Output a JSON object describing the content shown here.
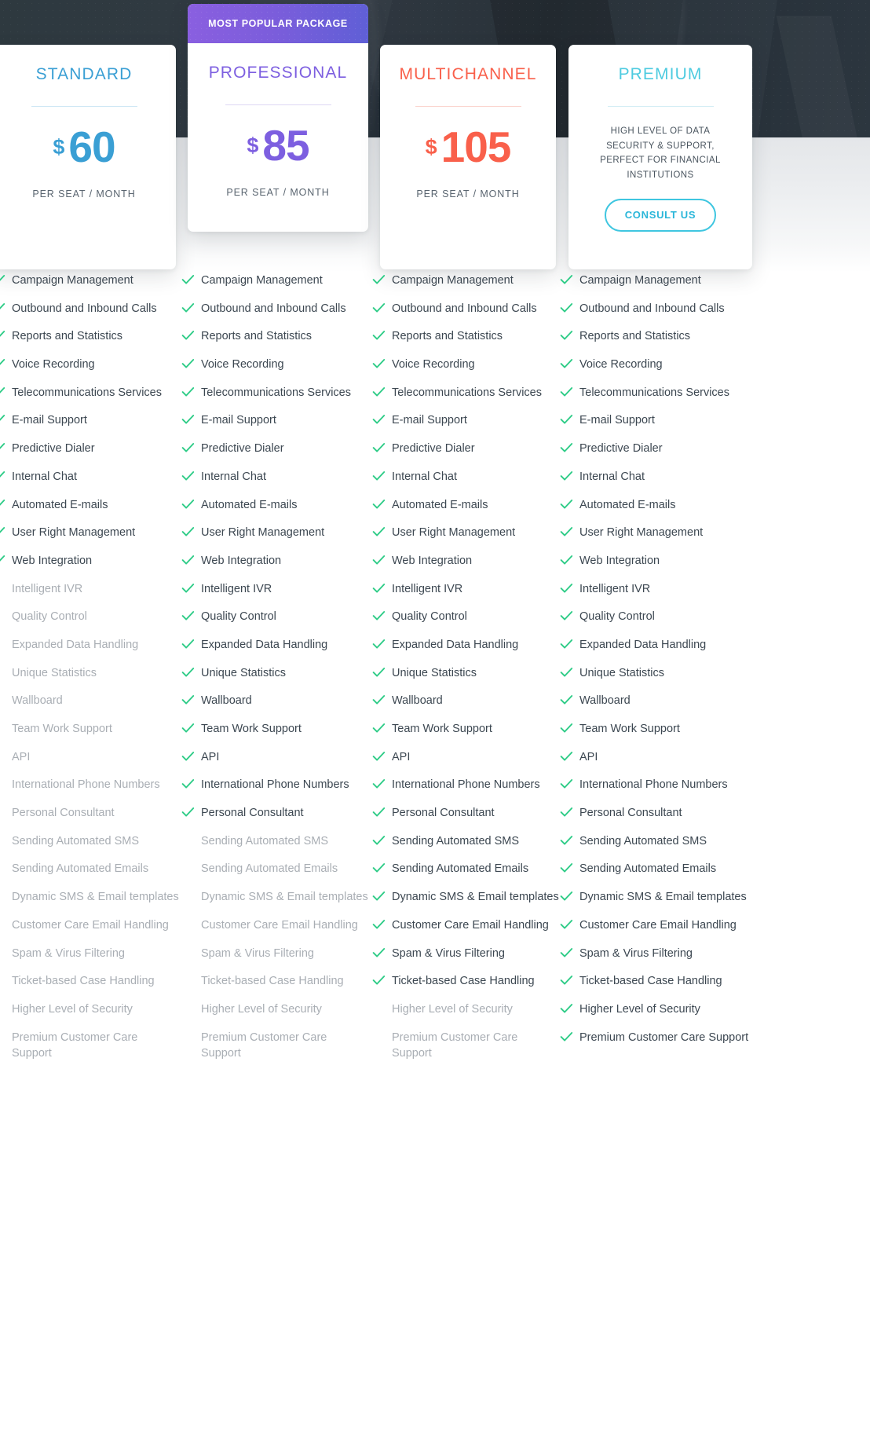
{
  "hero": {
    "popular_badge": "MOST POPULAR PACKAGE"
  },
  "colors": {
    "standard": "#3a9fd4",
    "professional": "#7d5fe0",
    "multichannel": "#f9604b",
    "premium": "#4ecbe0",
    "check": "#2ecc87",
    "disabled_text": "#a9aeb4",
    "enabled_text": "#3c4751",
    "banner_gradient_start": "#8a5fe0",
    "banner_gradient_end": "#5f5fd6",
    "hero_background": "#263238"
  },
  "plans": [
    {
      "name": "STANDARD",
      "currency": "$",
      "price": "60",
      "period": "PER SEAT / MONTH",
      "accent": "#3a9fd4",
      "rule_color": "#cfe8f5",
      "has_banner": false,
      "type": "priced"
    },
    {
      "name": "PROFESSIONAL",
      "currency": "$",
      "price": "85",
      "period": "PER SEAT / MONTH",
      "accent": "#7d5fe0",
      "rule_color": "#ddd7f3",
      "has_banner": true,
      "type": "priced"
    },
    {
      "name": "MULTICHANNEL",
      "currency": "$",
      "price": "105",
      "period": "PER SEAT / MONTH",
      "accent": "#f9604b",
      "rule_color": "#fbd5cf",
      "has_banner": false,
      "type": "priced"
    },
    {
      "name": "PREMIUM",
      "description": "HIGH LEVEL OF DATA SECURITY & SUPPORT, PERFECT FOR FINANCIAL INSTITUTIONS",
      "cta_label": "CONSULT US",
      "accent": "#4ecbe0",
      "rule_color": "#d4eef5",
      "has_banner": false,
      "type": "consult"
    }
  ],
  "features": [
    "Campaign Management",
    "Outbound and Inbound Calls",
    "Reports and Statistics",
    "Voice Recording",
    "Telecommunications Services",
    "E-mail Support",
    "Predictive Dialer",
    "Internal Chat",
    "Automated E-mails",
    "User Right Management",
    "Web Integration",
    "Intelligent IVR",
    "Quality Control",
    "Expanded Data Handling",
    "Unique Statistics",
    "Wallboard",
    "Team Work Support",
    "API",
    "International Phone Numbers",
    "Personal Consultant",
    "Sending Automated SMS",
    "Sending Automated Emails",
    "Dynamic SMS & Email templates",
    "Customer Care Email Handling",
    "Spam & Virus Filtering",
    "Ticket-based Case Handling",
    "Higher Level of Security",
    "Premium Customer Care Support"
  ],
  "feature_matrix": {
    "standard": [
      true,
      true,
      true,
      true,
      true,
      true,
      true,
      true,
      true,
      true,
      true,
      false,
      false,
      false,
      false,
      false,
      false,
      false,
      false,
      false,
      false,
      false,
      false,
      false,
      false,
      false,
      false,
      false
    ],
    "professional": [
      true,
      true,
      true,
      true,
      true,
      true,
      true,
      true,
      true,
      true,
      true,
      true,
      true,
      true,
      true,
      true,
      true,
      true,
      true,
      true,
      false,
      false,
      false,
      false,
      false,
      false,
      false,
      false
    ],
    "multichannel": [
      true,
      true,
      true,
      true,
      true,
      true,
      true,
      true,
      true,
      true,
      true,
      true,
      true,
      true,
      true,
      true,
      true,
      true,
      true,
      true,
      true,
      true,
      true,
      true,
      true,
      true,
      false,
      false
    ],
    "premium": [
      true,
      true,
      true,
      true,
      true,
      true,
      true,
      true,
      true,
      true,
      true,
      true,
      true,
      true,
      true,
      true,
      true,
      true,
      true,
      true,
      true,
      true,
      true,
      true,
      true,
      true,
      true,
      true
    ]
  },
  "column_keys": [
    "standard",
    "professional",
    "multichannel",
    "premium"
  ],
  "icons": {
    "check": "check-icon"
  }
}
